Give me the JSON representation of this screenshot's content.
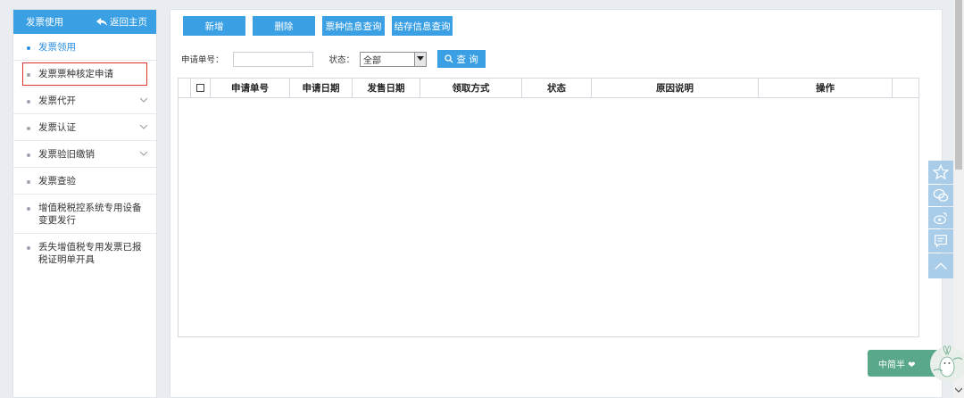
{
  "sidebar": {
    "title": "发票使用",
    "back_label": "返回主页",
    "items": [
      {
        "label": "发票领用",
        "has_chevron": false,
        "state": "active"
      },
      {
        "label": "发票票种核定申请",
        "has_chevron": false,
        "state": "selected"
      },
      {
        "label": "发票代开",
        "has_chevron": true
      },
      {
        "label": "发票认证",
        "has_chevron": true
      },
      {
        "label": "发票验旧缴销",
        "has_chevron": true
      },
      {
        "label": "发票查验",
        "has_chevron": false
      },
      {
        "label": "增值税税控系统专用设备变更发行",
        "has_chevron": false
      },
      {
        "label": "丢失增值税专用发票已报税证明单开具",
        "has_chevron": false
      }
    ]
  },
  "toolbar": {
    "new_label": "新增",
    "delete_label": "删除",
    "ticket_query_label": "票种信息查询",
    "stock_query_label": "结存信息查询"
  },
  "filter": {
    "app_no_label": "申请单号：",
    "app_no_value": "",
    "status_label": "状态：",
    "status_value": "全部",
    "search_label": "查 询"
  },
  "grid": {
    "columns": [
      "申请单号",
      "申请日期",
      "发售日期",
      "领取方式",
      "状态",
      "原因说明",
      "操作"
    ],
    "rows": []
  },
  "badge": {
    "text": "中简半 ❤"
  },
  "colors": {
    "accent": "#3ba0e3",
    "active_text": "#2a8de0",
    "selected_outline": "#e03434"
  }
}
